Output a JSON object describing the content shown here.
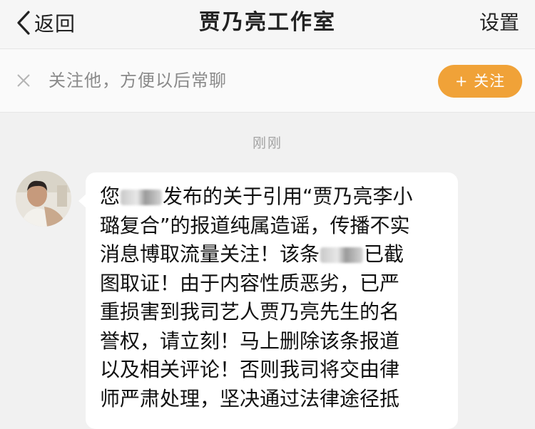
{
  "nav": {
    "back_label": "返回",
    "title": "贾乃亮工作室",
    "settings_label": "设置"
  },
  "follow_bar": {
    "prompt": "关注他，方便以后常聊",
    "follow_button": "+ 关注"
  },
  "conversation": {
    "timestamp": "刚刚",
    "message": {
      "lines": [
        [
          "您",
          "发布的关于引用“贾乃亮李小"
        ],
        "璐复合”的报道纯属造谣，传播不实",
        [
          "消息博取流量关注！该条",
          "已截"
        ],
        "图取证！由于内容性质恶劣，已严",
        "重损害到我司艺人贾乃亮先生的名",
        "誉权，请立刻！马上删除该条报道",
        "以及相关评论！否则我司将交由律",
        "师严肃处理，坚决通过法律途径抵"
      ]
    }
  },
  "colors": {
    "accent": "#f0a238",
    "background": "#f1f1f1",
    "bubble": "#ffffff"
  },
  "icons": {
    "back": "chevron-left-icon",
    "close": "close-icon"
  }
}
